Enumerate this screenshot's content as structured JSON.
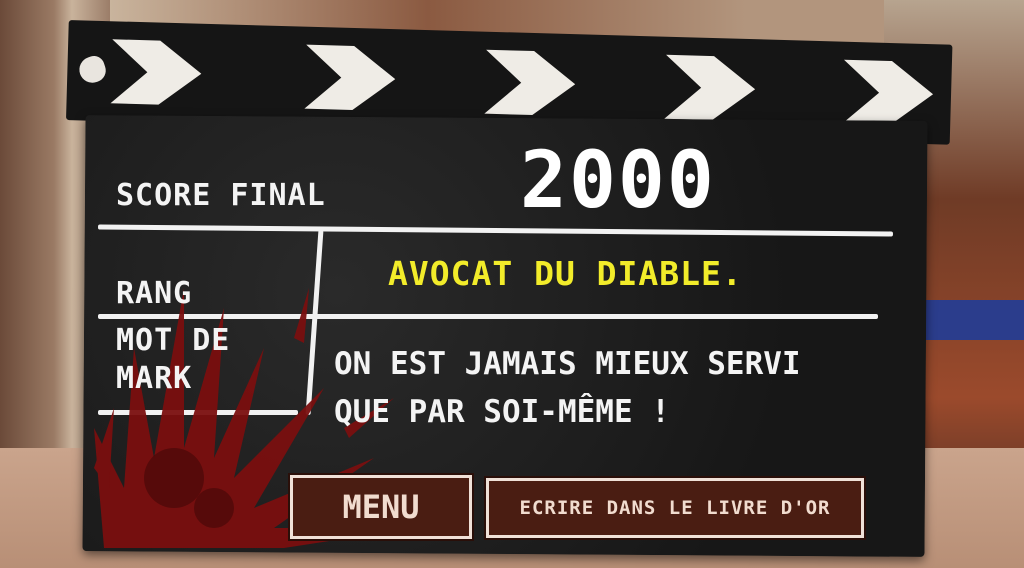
{
  "scoreboard": {
    "score_label": "SCORE FINAL",
    "score_value": "2000",
    "rank_label": "RANG",
    "rank_value": "AVOCAT DU DIABLE.",
    "quote_label": "MOT DE MARK",
    "quote_value": "ON EST JAMAIS MIEUX SERVI QUE PAR SOI-MÊME !"
  },
  "buttons": {
    "menu_label": "MENU",
    "guestbook_label": "ECRIRE DANS LE LIVRE D'OR"
  },
  "colors": {
    "board": "#1c1c1c",
    "rank_text": "#f2ec2a",
    "button_bg": "#4a1d12",
    "blood": "#7a0f0f"
  },
  "icons": [
    "clapperboard-chevron",
    "blood-splatter"
  ]
}
